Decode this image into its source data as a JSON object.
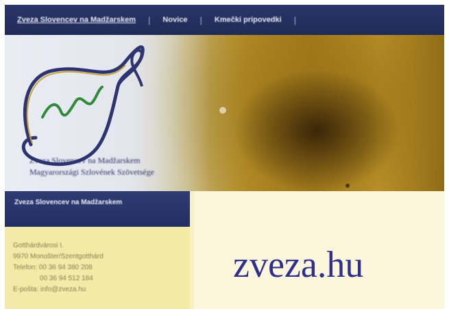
{
  "nav": {
    "items": [
      "Zveza Slovencev na Madžarskem",
      "Novice",
      "Kmečki pripovedki"
    ]
  },
  "banner": {
    "org_name_line1": "Zveza Slovencev na Madžarskem",
    "org_name_line2": "Magyarországi Szlovének Szövetsége"
  },
  "sidebar": {
    "heading": "Zveza Slovencev na Madžarskem",
    "lines": [
      "Gotthárdvárosi I.",
      "9970 Monošter/Szentgotthárd",
      "Telefon: 00 36 94 380 208",
      "              00 36 94 512 184",
      "E-pošta: info@zveza.hu"
    ]
  },
  "overlay": {
    "domain": "zveza.hu"
  },
  "colors": {
    "nav_bg": "#1f2a58",
    "sidebar_head_bg": "#243064",
    "sidebar_body_bg": "#f3eaa8",
    "domain_text": "#2e2f8e"
  }
}
